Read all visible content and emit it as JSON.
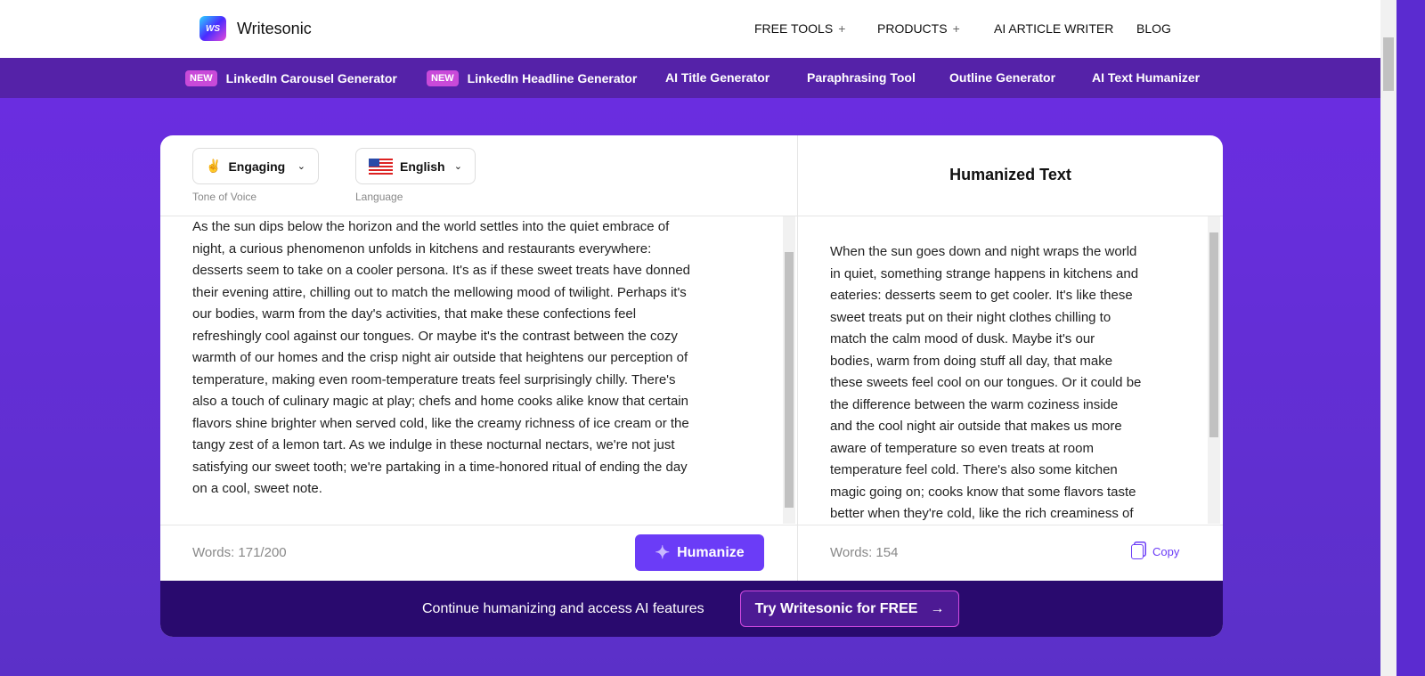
{
  "header": {
    "brand": "Writesonic",
    "logo_text": "WS",
    "nav": [
      {
        "label": "FREE TOOLS",
        "has_plus": true
      },
      {
        "label": "PRODUCTS",
        "has_plus": true
      },
      {
        "label": "AI ARTICLE WRITER",
        "has_plus": false
      },
      {
        "label": "BLOG",
        "has_plus": false
      }
    ]
  },
  "subnav": [
    {
      "label": "LinkedIn Carousel Generator",
      "badge": "NEW"
    },
    {
      "label": "LinkedIn Headline Generator",
      "badge": "NEW"
    },
    {
      "label": "AI Title Generator"
    },
    {
      "label": "Paraphrasing Tool"
    },
    {
      "label": "Outline Generator"
    },
    {
      "label": "AI Text Humanizer"
    }
  ],
  "tool": {
    "tone": {
      "emoji": "✌️",
      "value": "Engaging",
      "label": "Tone of Voice"
    },
    "language": {
      "value": "English",
      "label": "Language"
    },
    "output_title": "Humanized Text",
    "input_lines": [
      "As the sun dips below the horizon and the world settles into the quiet embrace of",
      "night, a curious phenomenon unfolds in kitchens and restaurants everywhere:",
      "desserts seem to take on a cooler persona. It's as if these sweet treats have donned",
      "their evening attire, chilling out to match the mellowing mood of twilight. Perhaps it's",
      "our bodies, warm from the day's activities, that make these confections feel",
      "refreshingly cool against our tongues. Or maybe it's the contrast between the cozy",
      "warmth of our homes and the crisp night air outside that heightens our perception of",
      "temperature, making even room-temperature treats feel surprisingly chilly. There's",
      "also a touch of culinary magic at play; chefs and home cooks alike know that certain",
      "flavors shine brighter when served cold, like the creamy richness of ice cream or the",
      "tangy zest of a lemon tart. As we indulge in these nocturnal nectars, we're not just",
      "satisfying our sweet tooth; we're partaking in a time-honored ritual of ending the day",
      "on a cool, sweet note."
    ],
    "output_lines": [
      "When the sun goes down and night wraps the world",
      "in quiet, something strange happens in kitchens and",
      "eateries: desserts seem to get cooler. It's like these",
      "sweet treats put on their night clothes chilling to",
      "match the calm mood of dusk. Maybe it's our",
      "bodies, warm from doing stuff all day, that make",
      "these sweets feel cool on our tongues. Or it could be",
      "the difference between the warm coziness inside",
      "and the cool night air outside that makes us more",
      "aware of temperature so even treats at room",
      "temperature feel cold. There's also some kitchen",
      "magic going on; cooks know that some flavors taste",
      "better when they're cold, like the rich creaminess of"
    ],
    "input_words": "Words: 171/200",
    "output_words": "Words: 154",
    "humanize_label": "Humanize",
    "copy_label": "Copy"
  },
  "footer": {
    "text": "Continue humanizing and access AI features",
    "cta": "Try Writesonic for FREE",
    "cta_arrow": "→"
  },
  "colors": {
    "accent": "#6b3cf7",
    "subnav_bg": "#5522a8",
    "footer_bg": "#290a6e",
    "badge": "#c94ad9"
  }
}
